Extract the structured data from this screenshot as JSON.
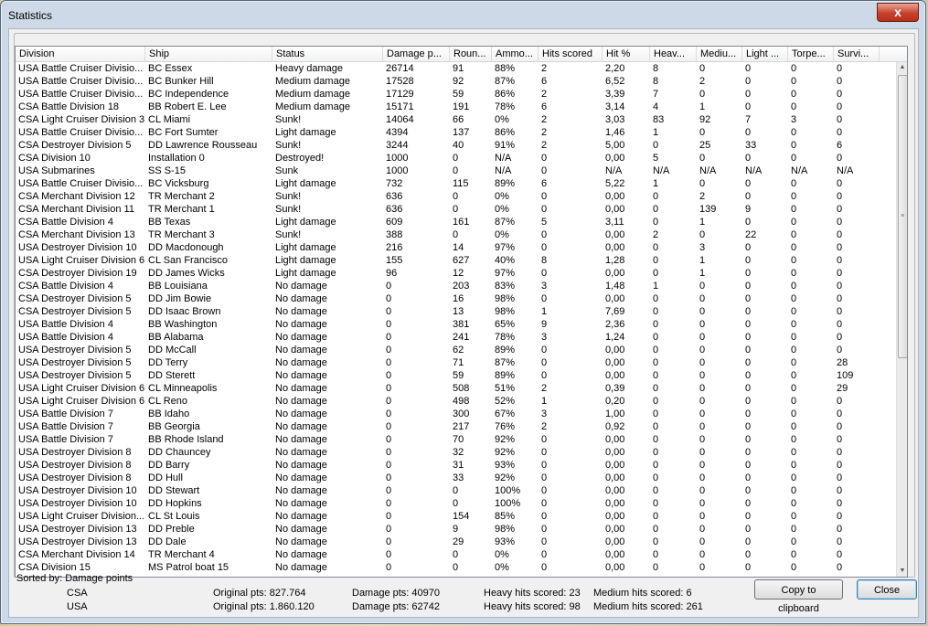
{
  "window": {
    "title": "Statistics",
    "close_glyph": "x"
  },
  "columns": [
    "Division",
    "Ship",
    "Status",
    "Damage p...",
    "Roun...",
    "Ammo...",
    "Hits scored",
    "Hit %",
    "Heav...",
    "Mediu...",
    "Light ...",
    "Torpe...",
    "Survi..."
  ],
  "rows": [
    [
      "USA Battle Cruiser Divisio...",
      "BC Essex",
      "Heavy damage",
      "26714",
      "91",
      "88%",
      "2",
      "2,20",
      "8",
      "0",
      "0",
      "0",
      "0"
    ],
    [
      "USA Battle Cruiser Divisio...",
      "BC Bunker Hill",
      "Medium damage",
      "17528",
      "92",
      "87%",
      "6",
      "6,52",
      "8",
      "2",
      "0",
      "0",
      "0"
    ],
    [
      "USA Battle Cruiser Divisio...",
      "BC Independence",
      "Medium damage",
      "17129",
      "59",
      "86%",
      "2",
      "3,39",
      "7",
      "0",
      "0",
      "0",
      "0"
    ],
    [
      "CSA Battle Division 18",
      "BB Robert E. Lee",
      "Medium damage",
      "15171",
      "191",
      "78%",
      "6",
      "3,14",
      "4",
      "1",
      "0",
      "0",
      "0"
    ],
    [
      "CSA Light Cruiser Division 3",
      "CL Miami",
      "Sunk!",
      "14064",
      "66",
      "0%",
      "2",
      "3,03",
      "83",
      "92",
      "7",
      "3",
      "0"
    ],
    [
      "USA Battle Cruiser Divisio...",
      "BC Fort Sumter",
      "Light damage",
      "4394",
      "137",
      "86%",
      "2",
      "1,46",
      "1",
      "0",
      "0",
      "0",
      "0"
    ],
    [
      "CSA Destroyer Division 5",
      "DD Lawrence Rousseau",
      "Sunk!",
      "3244",
      "40",
      "91%",
      "2",
      "5,00",
      "0",
      "25",
      "33",
      "0",
      "6"
    ],
    [
      "CSA  Division 10",
      "Installation 0",
      "Destroyed!",
      "1000",
      "0",
      "N/A",
      "0",
      "0,00",
      "5",
      "0",
      "0",
      "0",
      "0"
    ],
    [
      "USA Submarines",
      "SS S-15",
      "Sunk",
      "1000",
      "0",
      "N/A",
      "0",
      "N/A",
      "N/A",
      "N/A",
      "N/A",
      "N/A",
      "N/A"
    ],
    [
      "USA Battle Cruiser Divisio...",
      "BC Vicksburg",
      "Light damage",
      "732",
      "115",
      "89%",
      "6",
      "5,22",
      "1",
      "0",
      "0",
      "0",
      "0"
    ],
    [
      "CSA Merchant Division 12",
      "TR Merchant 2",
      "Sunk!",
      "636",
      "0",
      "0%",
      "0",
      "0,00",
      "0",
      "2",
      "0",
      "0",
      "0"
    ],
    [
      "CSA Merchant Division 11",
      "TR Merchant 1",
      "Sunk!",
      "636",
      "0",
      "0%",
      "0",
      "0,00",
      "0",
      "139",
      "9",
      "0",
      "0"
    ],
    [
      "CSA Battle Division 4",
      "BB Texas",
      "Light damage",
      "609",
      "161",
      "87%",
      "5",
      "3,11",
      "0",
      "1",
      "0",
      "0",
      "0"
    ],
    [
      "CSA Merchant Division 13",
      "TR Merchant 3",
      "Sunk!",
      "388",
      "0",
      "0%",
      "0",
      "0,00",
      "2",
      "0",
      "22",
      "0",
      "0"
    ],
    [
      "USA Destroyer Division 10",
      "DD Macdonough",
      "Light damage",
      "216",
      "14",
      "97%",
      "0",
      "0,00",
      "0",
      "3",
      "0",
      "0",
      "0"
    ],
    [
      "USA Light Cruiser Division 6",
      "CL San Francisco",
      "Light damage",
      "155",
      "627",
      "40%",
      "8",
      "1,28",
      "0",
      "1",
      "0",
      "0",
      "0"
    ],
    [
      "CSA Destroyer Division 19",
      "DD James Wicks",
      "Light damage",
      "96",
      "12",
      "97%",
      "0",
      "0,00",
      "0",
      "1",
      "0",
      "0",
      "0"
    ],
    [
      "CSA Battle Division 4",
      "BB Louisiana",
      "No damage",
      "0",
      "203",
      "83%",
      "3",
      "1,48",
      "1",
      "0",
      "0",
      "0",
      "0"
    ],
    [
      "CSA Destroyer Division 5",
      "DD Jim Bowie",
      "No damage",
      "0",
      "16",
      "98%",
      "0",
      "0,00",
      "0",
      "0",
      "0",
      "0",
      "0"
    ],
    [
      "CSA Destroyer Division 5",
      "DD Isaac Brown",
      "No damage",
      "0",
      "13",
      "98%",
      "1",
      "7,69",
      "0",
      "0",
      "0",
      "0",
      "0"
    ],
    [
      "USA Battle Division 4",
      "BB Washington",
      "No damage",
      "0",
      "381",
      "65%",
      "9",
      "2,36",
      "0",
      "0",
      "0",
      "0",
      "0"
    ],
    [
      "USA Battle Division 4",
      "BB Alabama",
      "No damage",
      "0",
      "241",
      "78%",
      "3",
      "1,24",
      "0",
      "0",
      "0",
      "0",
      "0"
    ],
    [
      "USA Destroyer Division 5",
      "DD McCall",
      "No damage",
      "0",
      "62",
      "89%",
      "0",
      "0,00",
      "0",
      "0",
      "0",
      "0",
      "0"
    ],
    [
      "USA Destroyer Division 5",
      "DD Terry",
      "No damage",
      "0",
      "71",
      "87%",
      "0",
      "0,00",
      "0",
      "0",
      "0",
      "0",
      "28"
    ],
    [
      "USA Destroyer Division 5",
      "DD Sterett",
      "No damage",
      "0",
      "59",
      "89%",
      "0",
      "0,00",
      "0",
      "0",
      "0",
      "0",
      "109"
    ],
    [
      "USA Light Cruiser Division 6",
      "CL Minneapolis",
      "No damage",
      "0",
      "508",
      "51%",
      "2",
      "0,39",
      "0",
      "0",
      "0",
      "0",
      "29"
    ],
    [
      "USA Light Cruiser Division 6",
      "CL Reno",
      "No damage",
      "0",
      "498",
      "52%",
      "1",
      "0,20",
      "0",
      "0",
      "0",
      "0",
      "0"
    ],
    [
      "USA Battle Division 7",
      "BB Idaho",
      "No damage",
      "0",
      "300",
      "67%",
      "3",
      "1,00",
      "0",
      "0",
      "0",
      "0",
      "0"
    ],
    [
      "USA Battle Division 7",
      "BB Georgia",
      "No damage",
      "0",
      "217",
      "76%",
      "2",
      "0,92",
      "0",
      "0",
      "0",
      "0",
      "0"
    ],
    [
      "USA Battle Division 7",
      "BB Rhode Island",
      "No damage",
      "0",
      "70",
      "92%",
      "0",
      "0,00",
      "0",
      "0",
      "0",
      "0",
      "0"
    ],
    [
      "USA Destroyer Division 8",
      "DD Chauncey",
      "No damage",
      "0",
      "32",
      "92%",
      "0",
      "0,00",
      "0",
      "0",
      "0",
      "0",
      "0"
    ],
    [
      "USA Destroyer Division 8",
      "DD Barry",
      "No damage",
      "0",
      "31",
      "93%",
      "0",
      "0,00",
      "0",
      "0",
      "0",
      "0",
      "0"
    ],
    [
      "USA Destroyer Division 8",
      "DD Hull",
      "No damage",
      "0",
      "33",
      "92%",
      "0",
      "0,00",
      "0",
      "0",
      "0",
      "0",
      "0"
    ],
    [
      "USA Destroyer Division 10",
      "DD Stewart",
      "No damage",
      "0",
      "0",
      "100%",
      "0",
      "0,00",
      "0",
      "0",
      "0",
      "0",
      "0"
    ],
    [
      "USA Destroyer Division 10",
      "DD Hopkins",
      "No damage",
      "0",
      "0",
      "100%",
      "0",
      "0,00",
      "0",
      "0",
      "0",
      "0",
      "0"
    ],
    [
      "USA Light Cruiser Division...",
      "CL St Louis",
      "No damage",
      "0",
      "154",
      "85%",
      "0",
      "0,00",
      "0",
      "0",
      "0",
      "0",
      "0"
    ],
    [
      "USA Destroyer Division 13",
      "DD Preble",
      "No damage",
      "0",
      "9",
      "98%",
      "0",
      "0,00",
      "0",
      "0",
      "0",
      "0",
      "0"
    ],
    [
      "USA Destroyer Division 13",
      "DD Dale",
      "No damage",
      "0",
      "29",
      "93%",
      "0",
      "0,00",
      "0",
      "0",
      "0",
      "0",
      "0"
    ],
    [
      "CSA Merchant Division 14",
      "TR Merchant 4",
      "No damage",
      "0",
      "0",
      "0%",
      "0",
      "0,00",
      "0",
      "0",
      "0",
      "0",
      "0"
    ],
    [
      "CSA  Division 15",
      "MS Patrol boat 15",
      "No damage",
      "0",
      "0",
      "0%",
      "0",
      "0,00",
      "0",
      "0",
      "0",
      "0",
      "0"
    ]
  ],
  "footer": {
    "sorted_by": "Sorted by: Damage points",
    "summary": [
      {
        "side": "CSA",
        "original": "Original pts: 827.764",
        "damage": "Damage pts: 40970",
        "heavy": "Heavy hits scored: 23",
        "medium": "Medium hits scored: 6"
      },
      {
        "side": "USA",
        "original": "Original pts: 1.860.120",
        "damage": "Damage pts: 62742",
        "heavy": "Heavy hits scored: 98",
        "medium": "Medium hits scored: 261"
      }
    ],
    "copy_label": "Copy to clipboard",
    "close_label": "Close"
  }
}
